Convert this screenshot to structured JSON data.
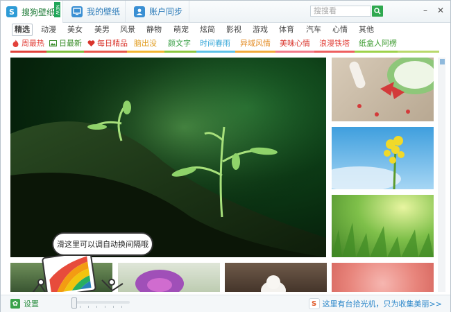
{
  "tabs": [
    {
      "label": "搜狗壁纸",
      "icon": "sogou-logo-icon",
      "badge": "NEW"
    },
    {
      "label": "我的壁纸",
      "icon": "monitor-icon"
    },
    {
      "label": "账户同步",
      "icon": "user-icon"
    }
  ],
  "search": {
    "placeholder": "搜搜看"
  },
  "window_controls": {
    "minimize": "–",
    "close": "✕"
  },
  "categories": [
    "精选",
    "动漫",
    "美女",
    "美男",
    "风景",
    "静物",
    "萌宠",
    "炫简",
    "影视",
    "游戏",
    "体育",
    "汽车",
    "心情",
    "其他"
  ],
  "featured": [
    {
      "label": "周最热",
      "color": "#e2413a",
      "icon": "fire-icon"
    },
    {
      "label": "日最新",
      "color": "#3b8d2a",
      "icon": "picture-icon"
    },
    {
      "label": "每日精品",
      "color": "#d9342b",
      "icon": "heart-icon"
    },
    {
      "label": "脑出没",
      "color": "#e09a1a",
      "icon": ""
    },
    {
      "label": "颜文字",
      "color": "#2f9a3c",
      "icon": ""
    },
    {
      "label": "时间春雨",
      "color": "#39a8d8",
      "icon": ""
    },
    {
      "label": "异域风情",
      "color": "#e38b23",
      "icon": ""
    },
    {
      "label": "美味心情",
      "color": "#d9342b",
      "icon": ""
    },
    {
      "label": "浪漫铁塔",
      "color": "#e2413a",
      "icon": ""
    },
    {
      "label": "纸盒人阿楞",
      "color": "#3a9a2d",
      "icon": ""
    }
  ],
  "bubble_text": "滑这里可以调自动换间隔哦",
  "bottom": {
    "settings_label": "设置",
    "promo_text": "这里有台拾光机，只为收集美丽>>"
  },
  "colors": {
    "accent_green": "#2fa84f",
    "link_blue": "#2a7ab8"
  }
}
